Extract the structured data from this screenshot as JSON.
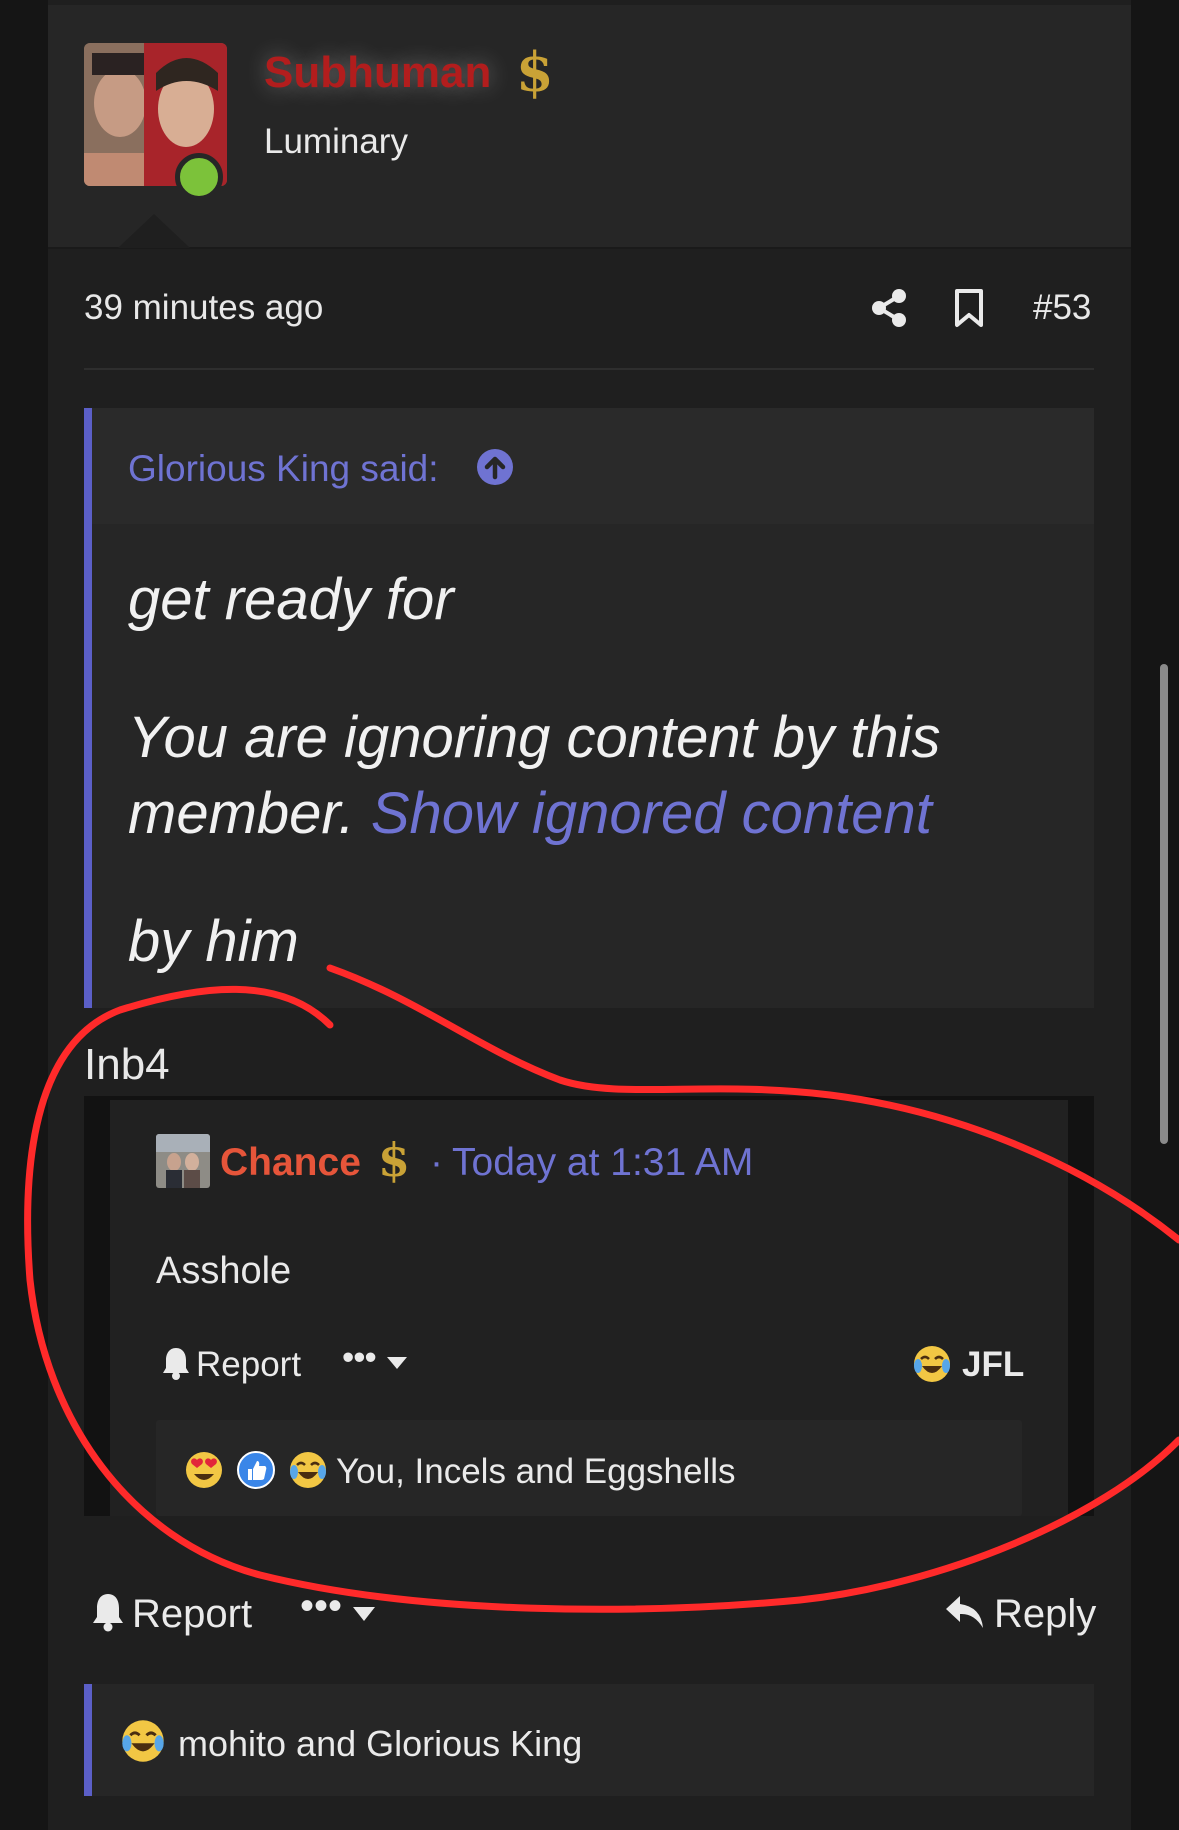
{
  "post": {
    "author": {
      "name": "Subhuman",
      "title": "Luminary",
      "badge": "$"
    },
    "time": "39 minutes ago",
    "number": "#53",
    "quote": {
      "author_line": "Glorious King said:",
      "line1": "get ready for",
      "line2": "You are ignoring content by this",
      "line3_prefix": "member.",
      "line3_link": "Show ignored content",
      "line4": "by him"
    },
    "body": "Inb4",
    "actions": {
      "report": "Report",
      "more": "•••",
      "reply": "Reply"
    },
    "reactions_summary": "mohito and Glorious King"
  },
  "embedded": {
    "author": "Chance",
    "badge": "$",
    "separator": "·",
    "time": "Today at 1:31 AM",
    "body": "Asshole",
    "report": "Report",
    "more": "•••",
    "react_label": "JFL",
    "reactions_summary": "You, Incels and Eggshells"
  },
  "colors": {
    "background": "#1f1f1f",
    "link": "#6f73d2",
    "username_red": "#b21d1d",
    "chance_orange": "#e6553a",
    "online_green": "#7cc23a",
    "annotation_red": "#ff2a2a"
  },
  "icons": [
    "share-icon",
    "bookmark-icon",
    "arrow-up-circle-icon",
    "bell-icon",
    "caret-down-icon",
    "reply-icon",
    "heart-eyes-emoji-icon",
    "like-icon",
    "tears-of-joy-emoji-icon"
  ]
}
